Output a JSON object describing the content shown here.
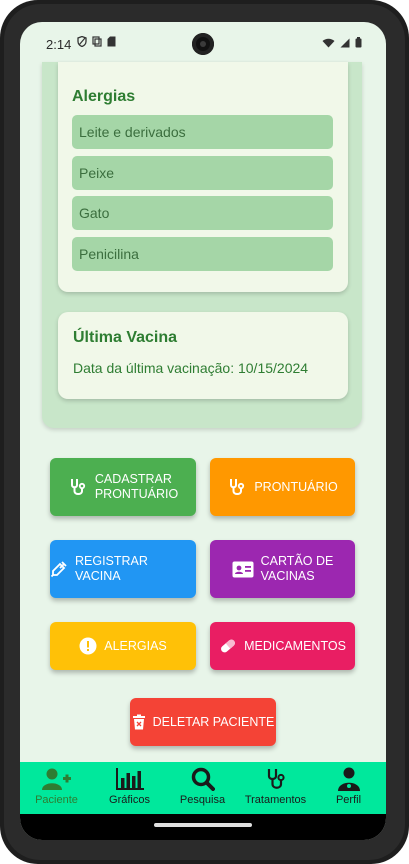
{
  "status": {
    "time": "2:14"
  },
  "allergies": {
    "title": "Alergias",
    "items": [
      "Leite e derivados",
      "Peixe",
      "Gato",
      "Penicilina"
    ]
  },
  "vaccine": {
    "title": "Última Vacina",
    "text": "Data da última vacinação: 10/15/2024"
  },
  "buttons": {
    "cadastrar_line1": "CADASTRAR",
    "cadastrar_line2": "PRONTUÁRIO",
    "prontuario": "PRONTUÁRIO",
    "registrar_vacina": "REGISTRAR VACINA",
    "cartao_line1": "CARTÃO DE",
    "cartao_line2": "VACINAS",
    "alergias": "ALERGIAS",
    "medicamentos": "MEDICAMENTOS",
    "deletar": "DELETAR PACIENTE"
  },
  "colors": {
    "green": "#4caf50",
    "orange": "#ff9800",
    "blue": "#2196f3",
    "purple": "#9c27b0",
    "yellow": "#ffc107",
    "pink": "#e91e63",
    "red": "#f44336",
    "nav": "#00e89c"
  },
  "nav": {
    "paciente": "Paciente",
    "graficos": "Gráficos",
    "pesquisa": "Pesquisa",
    "tratamentos": "Tratamentos",
    "perfil": "Perfil"
  }
}
